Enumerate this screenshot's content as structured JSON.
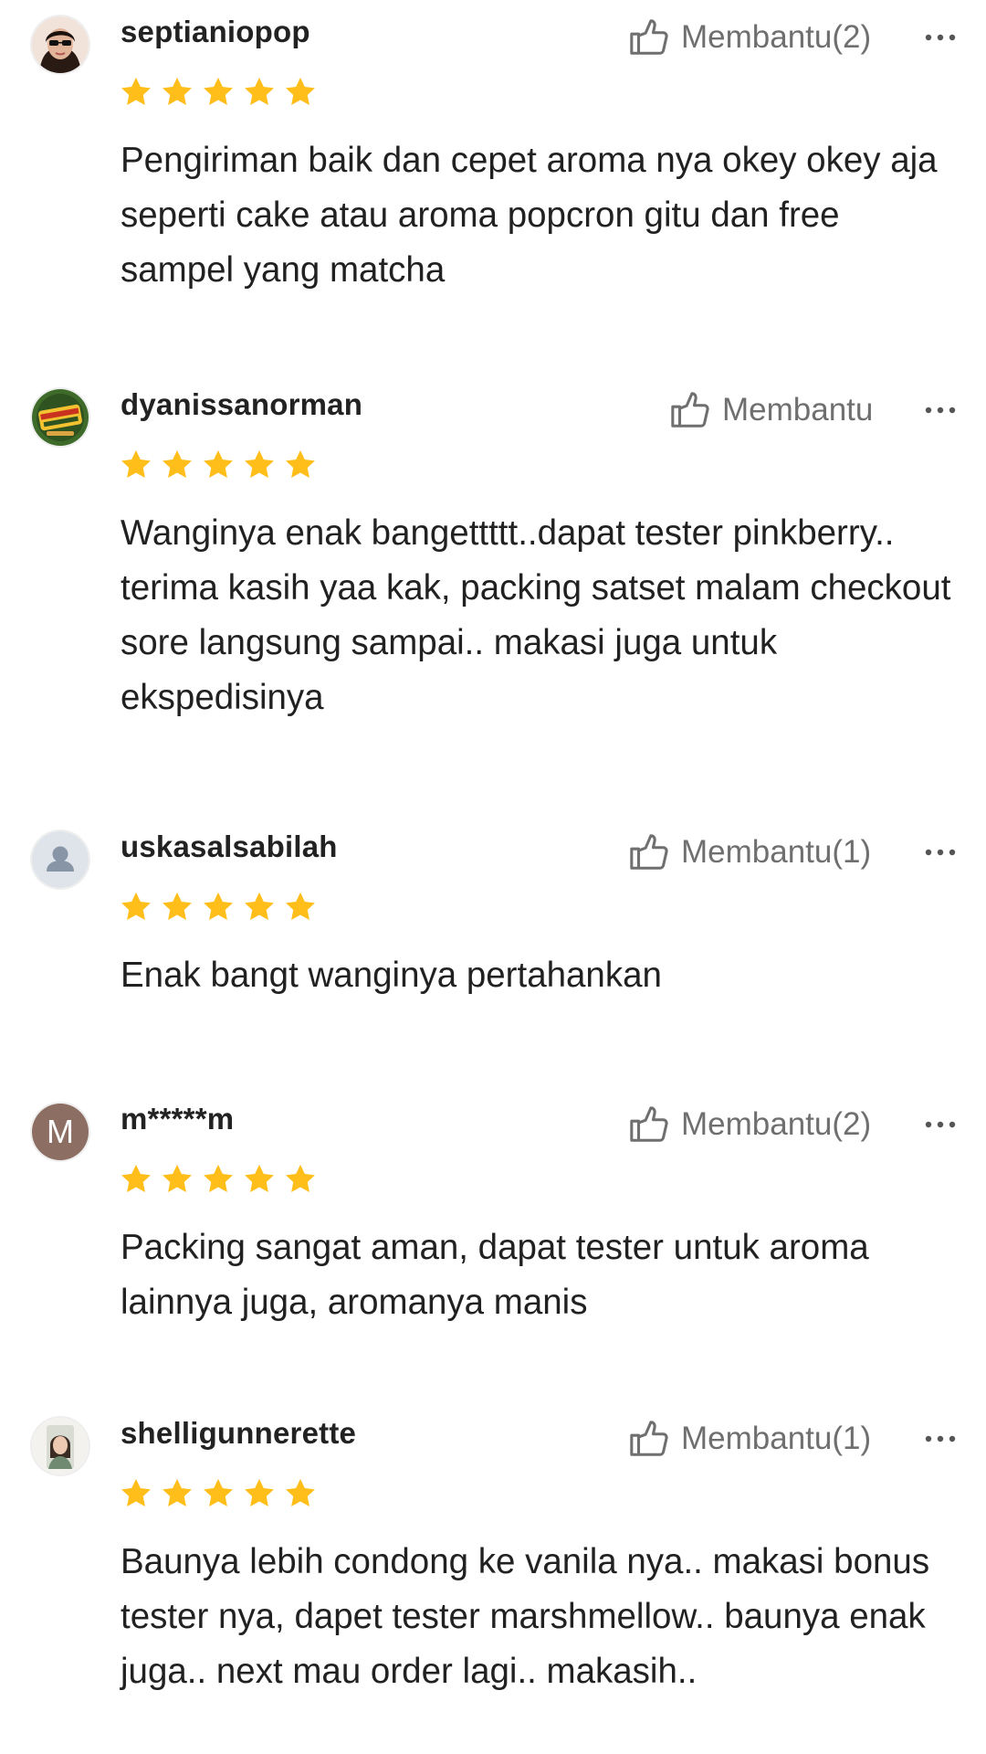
{
  "reviews": [
    {
      "username": "septianiopop",
      "helpful_label": "Membantu(2)",
      "rating": 5,
      "text": "Pengiriman baik dan cepet aroma nya okey okey aja seperti cake atau aroma popcron gitu dan free sampel yang matcha",
      "avatar": "photo-avatar"
    },
    {
      "username": "dyanissanorman",
      "helpful_label": "Membantu",
      "rating": 5,
      "text": "Wanginya enak bangettttt..dapat tester pinkberry.. terima kasih yaa kak, packing satset malam checkout sore langsung sampai.. makasi juga untuk ekspedisinya",
      "avatar": "photo-avatar"
    },
    {
      "username": "uskasalsabilah",
      "helpful_label": "Membantu(1)",
      "rating": 5,
      "text": "Enak bangt wanginya pertahankan",
      "avatar": "default-user-icon"
    },
    {
      "username": "m*****m",
      "helpful_label": "Membantu(2)",
      "rating": 5,
      "text": "Packing sangat aman, dapat tester untuk aroma lainnya juga, aromanya manis",
      "avatar_letter": "M"
    },
    {
      "username": "shelligunnerette",
      "helpful_label": "Membantu(1)",
      "rating": 5,
      "text": "Baunya lebih condong ke vanila nya.. makasi bonus tester nya, dapet tester marshmellow.. baunya enak juga.. next mau order lagi.. makasih..",
      "avatar": "photo-avatar"
    }
  ],
  "colors": {
    "star": "#FFBE1A",
    "helpful_text": "#6F6F6F",
    "text": "#212121",
    "letter_avatar_bg": "#8D6E63"
  },
  "icons": {
    "thumb": "thumb-up-outline-icon",
    "more": "more-horizontal-icon",
    "star": "star-icon"
  }
}
